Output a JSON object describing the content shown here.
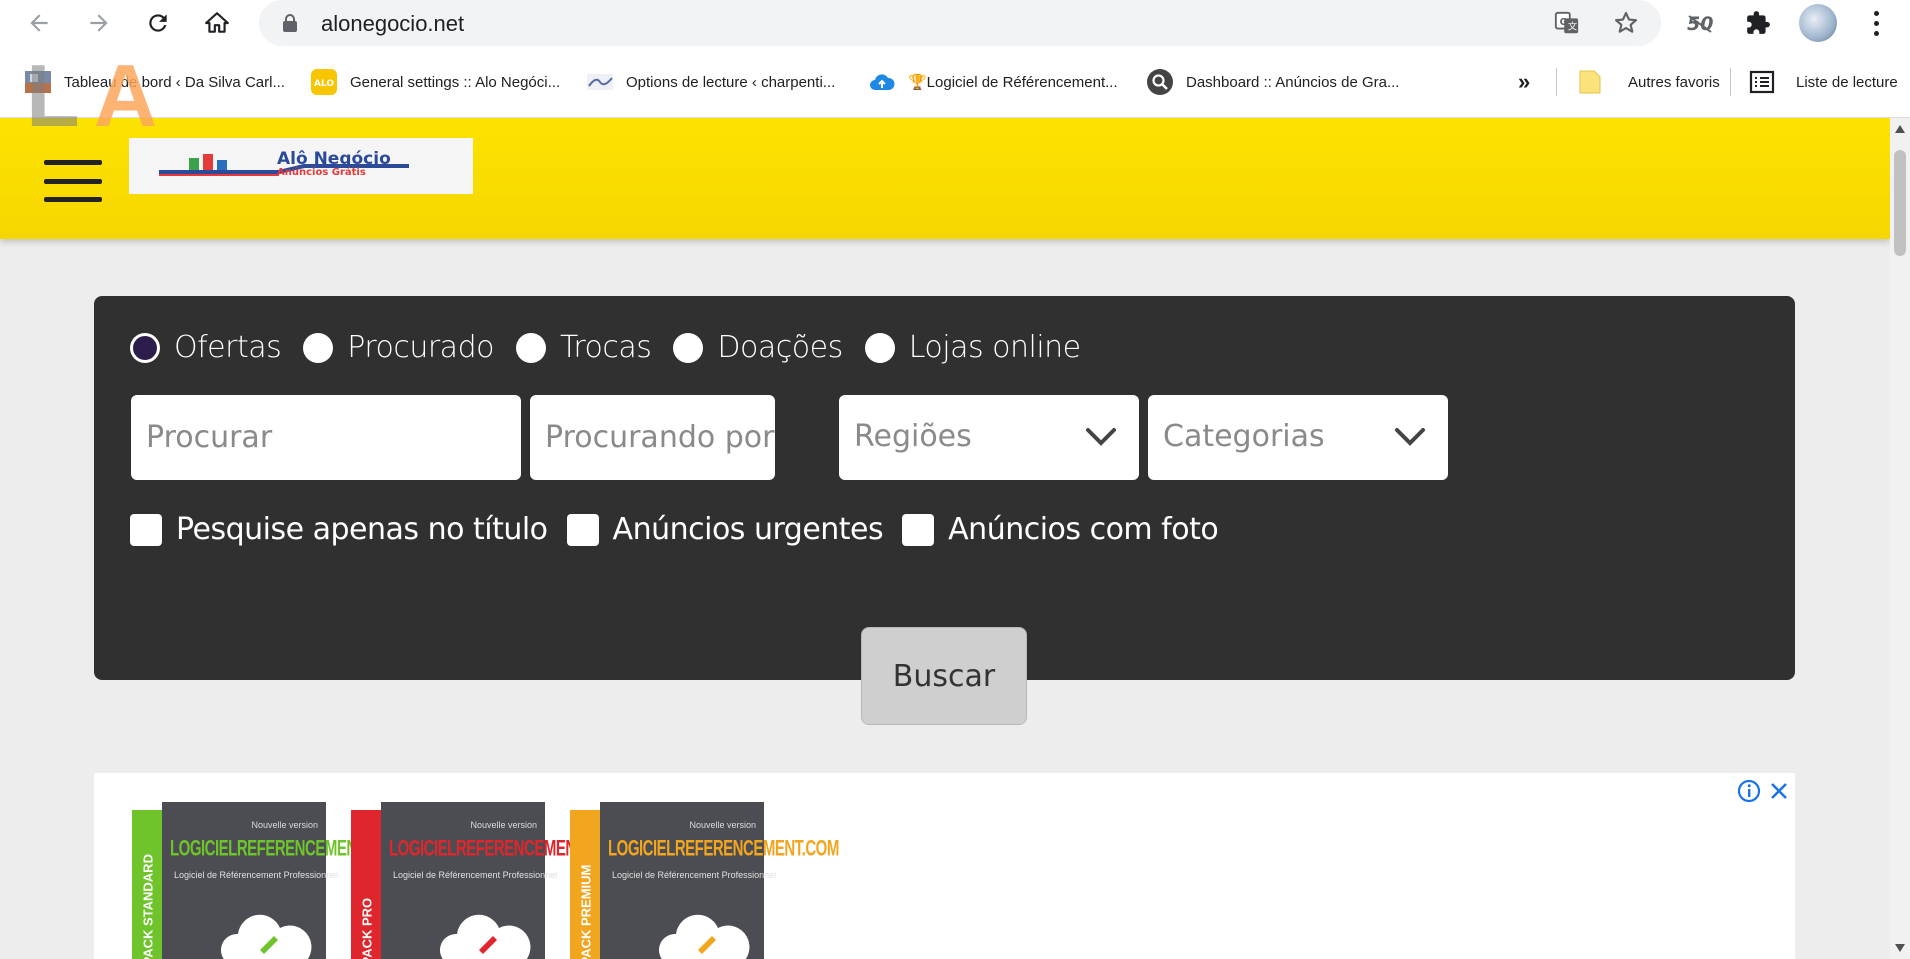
{
  "browser": {
    "url": "alonegocio.net",
    "bookmarks": [
      {
        "label": "Tableau de bord ‹ Da Silva Carl...",
        "icon": "site-thumbnail-icon"
      },
      {
        "label": "General settings :: Alo Negóci...",
        "icon": "alo-logo-icon"
      },
      {
        "label": "Options de lecture ‹ charpenti...",
        "icon": "site-thumbnail-icon"
      },
      {
        "label": "🏆Logiciel de Référencement...",
        "icon": "cloud-icon"
      },
      {
        "label": "Dashboard :: Anúncios de Gra...",
        "icon": "search-icon"
      }
    ],
    "more_bookmarks": "»",
    "other_favorites": "Autres favoris",
    "reading_list": "Liste de lecture"
  },
  "overlay_text": {
    "l": "L",
    "a": "A"
  },
  "header": {
    "logo_title": "Alô Negócio",
    "logo_subtitle": "Anúncios Grátis",
    "accent_color": "#fde300"
  },
  "search": {
    "types": [
      {
        "label": "Ofertas",
        "checked": true
      },
      {
        "label": "Procurado",
        "checked": false
      },
      {
        "label": "Trocas",
        "checked": false
      },
      {
        "label": "Doações",
        "checked": false
      },
      {
        "label": "Lojas online",
        "checked": false
      }
    ],
    "query_placeholder": "Procurar",
    "seeking_placeholder": "Procurando por....",
    "regions_label": "Regiões",
    "categories_label": "Categorias",
    "options": [
      {
        "label": "Pesquise apenas no título",
        "checked": false
      },
      {
        "label": "Anúncios urgentes",
        "checked": false
      },
      {
        "label": "Anúncios com foto",
        "checked": false
      }
    ],
    "submit_label": "Buscar"
  },
  "ad": {
    "products": [
      {
        "pack": "PACK STANDARD",
        "brand": "LOGICIELREFERENCEMENT.COM",
        "subtitle": "Logiciel de Référencement Professionnel",
        "new_version": "Nouvelle version",
        "color": "#6ec42a"
      },
      {
        "pack": "PACK PRO",
        "brand": "LOGICIELREFERENCEMENT.COM",
        "subtitle": "Logiciel de Référencement Professionnel",
        "new_version": "Nouvelle version",
        "color": "#e0262d"
      },
      {
        "pack": "PACK PREMIUM",
        "brand": "LOGICIELREFERENCEMENT.COM",
        "subtitle": "Logiciel de Référencement Professionnel",
        "new_version": "Nouvelle version",
        "color": "#f2a51f"
      }
    ]
  }
}
